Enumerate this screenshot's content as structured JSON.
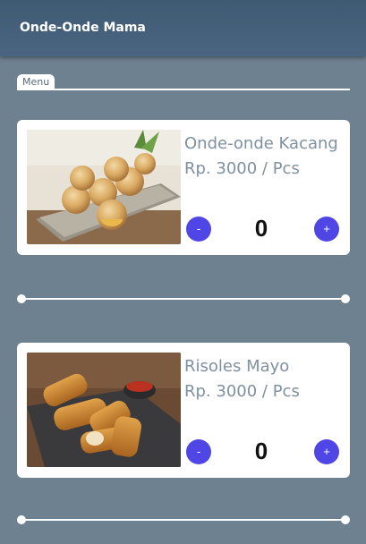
{
  "app_bar": {
    "title": "Onde-Onde Mama"
  },
  "section": {
    "label": "Menu"
  },
  "items": [
    {
      "name": "Onde-onde Kacang",
      "price": "Rp. 3000 / Pcs",
      "quantity": "0",
      "minus_label": "-",
      "plus_label": "+",
      "image_icon": "onde-onde-photo"
    },
    {
      "name": "Risoles Mayo",
      "price": "Rp. 3000 / Pcs",
      "quantity": "0",
      "minus_label": "-",
      "plus_label": "+",
      "image_icon": "risoles-photo"
    }
  ],
  "colors": {
    "app_bar": "#445f79",
    "background": "#6e8191",
    "button": "#5046e5",
    "text_muted": "#7f90a0"
  }
}
